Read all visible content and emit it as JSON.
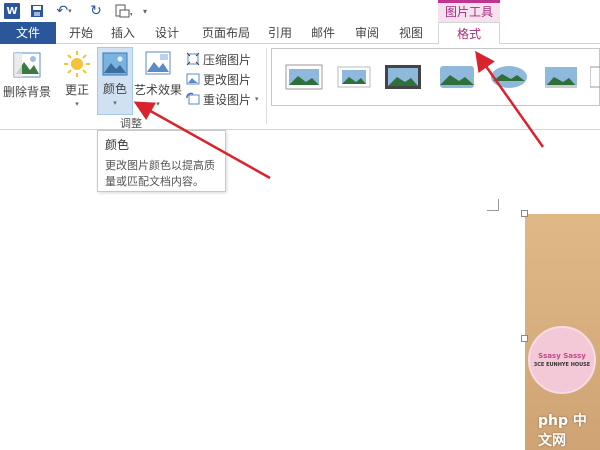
{
  "titlebar": {
    "word_logo": "W",
    "contextual_group": "图片工具"
  },
  "tabs": [
    {
      "label": "文件"
    },
    {
      "label": "开始"
    },
    {
      "label": "插入"
    },
    {
      "label": "设计"
    },
    {
      "label": "页面布局"
    },
    {
      "label": "引用"
    },
    {
      "label": "邮件"
    },
    {
      "label": "审阅"
    },
    {
      "label": "视图"
    },
    {
      "label": "格式"
    }
  ],
  "ribbon": {
    "remove_background": "删除背景",
    "corrections": "更正",
    "color": "颜色",
    "artistic_effects": "艺术效果",
    "compress_pictures": "压缩图片",
    "change_picture": "更改图片",
    "reset_picture": "重设图片",
    "group_adjust": "调整"
  },
  "tooltip": {
    "title": "颜色",
    "body": "更改图片颜色以提高质量或匹配文档内容。"
  },
  "picture": {
    "brand": "Ssasy Sassy",
    "subtitle": "3CE EUNHYE HOUSE"
  },
  "watermark": "php 中文网",
  "icons": {
    "accent": "#2b579a",
    "contextual": "#a42c7d",
    "arrow": "#d9232e"
  }
}
